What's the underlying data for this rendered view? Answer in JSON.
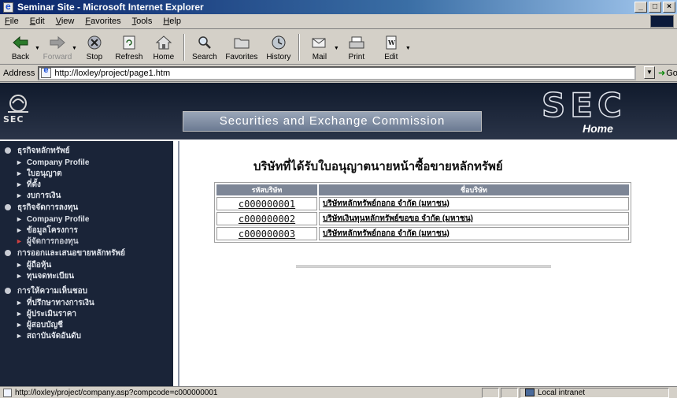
{
  "window": {
    "title": "Seminar Site - Microsoft Internet Explorer",
    "buttons": {
      "minimize": "_",
      "maximize": "□",
      "close": "×"
    }
  },
  "menu": [
    "File",
    "Edit",
    "View",
    "Favorites",
    "Tools",
    "Help"
  ],
  "toolbar": {
    "back": "Back",
    "forward": "Forward",
    "stop": "Stop",
    "refresh": "Refresh",
    "home": "Home",
    "search": "Search",
    "favorites": "Favorites",
    "history": "History",
    "mail": "Mail",
    "print": "Print",
    "edit": "Edit"
  },
  "address": {
    "label": "Address",
    "value": "http://loxley/project/page1.htm",
    "go": "Go"
  },
  "banner": {
    "logo_text": "SEC",
    "title": "Securities and Exchange Commission",
    "big_logo": "SEC",
    "home": "Home"
  },
  "nav": {
    "group1": {
      "label": "ธุรกิจหลักทรัพย์",
      "items": [
        "Company Profile",
        "ใบอนุญาต",
        "ที่ตั้ง",
        "งบการเงิน"
      ]
    },
    "group2": {
      "label": "ธุรกิจจัดการลงทุน",
      "items": [
        "Company Profile",
        "ข้อมูลโครงการ",
        "ผู้จัดการกองทุน"
      ]
    },
    "group3": {
      "label": "การออกและเสนอขายหลักทรัพย์",
      "items": [
        "ผู้ถือหุ้น",
        "ทุนจดทะเบียน"
      ]
    },
    "group4": {
      "label": "การให้ความเห็นชอบ",
      "items": [
        "ที่ปรึกษาทางการเงิน",
        "ผู้ประเมินราคา",
        "ผู้สอบบัญชี",
        "สถาบันจัดอันดับ"
      ]
    }
  },
  "main": {
    "heading": "บริษัทที่ได้รับใบอนุญาตนายหน้าซื้อขายหลักทรัพย์",
    "columns": [
      "รหัสบริษัท",
      "ชื่อบริษัท"
    ],
    "rows": [
      {
        "code": "c000000001",
        "name": "บริษัทหลักทรัพย์กอกอ จำกัด (มหาชน)"
      },
      {
        "code": "c000000002",
        "name": "บริษัทเงินทุนหลักทรัพย์ขอขอ จำกัด (มหาชน)"
      },
      {
        "code": "c000000003",
        "name": "บริษัทหลักทรัพย์กอกอ จำกัด (มหาชน)"
      }
    ]
  },
  "status": {
    "text": "http://loxley/project/company.asp?compcode=c000000001",
    "zone": "Local intranet"
  },
  "colors": {
    "titlebar": "#0a246a",
    "banner": "#101a2c",
    "nav_bg": "#1a2438",
    "header_cell": "#7d8696"
  }
}
